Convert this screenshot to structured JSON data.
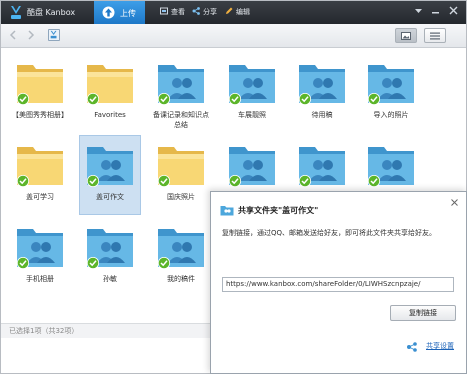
{
  "app": {
    "title": "酷盘 Kanbox"
  },
  "toolbar": {
    "upload": "上传",
    "view": "查看",
    "share": "分享",
    "edit": "编辑"
  },
  "folders": [
    {
      "name": "【美图秀秀相册】",
      "type": "plain",
      "selected": false
    },
    {
      "name": "Favorites",
      "type": "plain",
      "selected": false
    },
    {
      "name": "备课记录和知识点总结",
      "type": "shared",
      "selected": false
    },
    {
      "name": "车展靓照",
      "type": "shared",
      "selected": false
    },
    {
      "name": "待用稿",
      "type": "shared",
      "selected": false
    },
    {
      "name": "导入的照片",
      "type": "shared",
      "selected": false
    },
    {
      "name": "盖可学习",
      "type": "plain",
      "selected": false
    },
    {
      "name": "盖可作文",
      "type": "shared",
      "selected": true
    },
    {
      "name": "国庆照片",
      "type": "plain",
      "selected": false
    },
    {
      "name": "",
      "type": "shared",
      "selected": false
    },
    {
      "name": "",
      "type": "shared",
      "selected": false
    },
    {
      "name": "",
      "type": "shared",
      "selected": false
    },
    {
      "name": "手机相册",
      "type": "shared",
      "selected": false
    },
    {
      "name": "孙敏",
      "type": "shared",
      "selected": false
    },
    {
      "name": "我的稿件",
      "type": "shared",
      "selected": false
    },
    {
      "name": "",
      "type": "plain",
      "selected": false
    },
    {
      "name": "",
      "type": "plain",
      "selected": false
    },
    {
      "name": "",
      "type": "photo",
      "selected": false
    }
  ],
  "status": {
    "text": "已选择1项（共32项）"
  },
  "share_dialog": {
    "title": "共享文件夹\"盖可作文\"",
    "description": "复制链接，通过QQ、邮箱发送给好友，即可将此文件夹共享给好友。",
    "url": "https://www.kanbox.com/shareFolder/0/LIWHSzcnpzaje/",
    "copy_button": "复制链接",
    "settings_link": "共享设置"
  },
  "colors": {
    "titlebar": "#2b3036",
    "accent": "#2a88d8",
    "folder_yellow": "#f7d16a",
    "folder_blue": "#5fb3e2",
    "check_green": "#5cb52a"
  }
}
